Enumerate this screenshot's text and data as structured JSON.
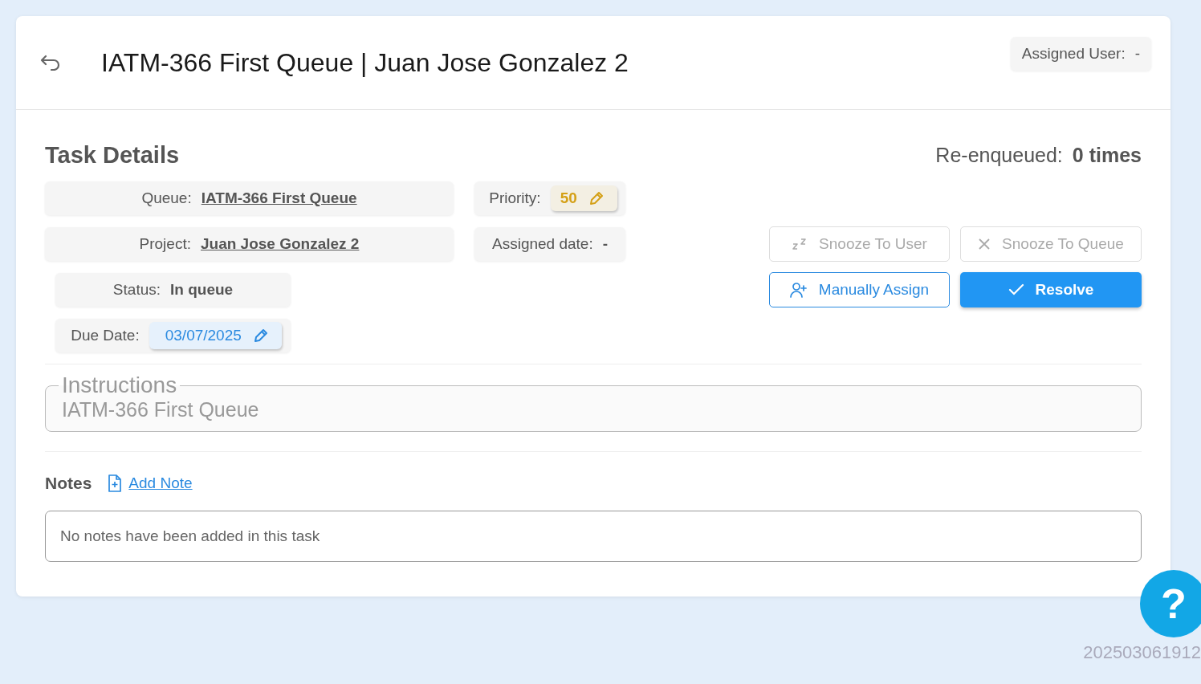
{
  "header": {
    "title": "IATM-366 First Queue | Juan Jose Gonzalez 2",
    "assigned_user": {
      "label": "Assigned User:",
      "value": "-"
    }
  },
  "details": {
    "title": "Task Details",
    "reenqueued": {
      "label": "Re-enqueued:",
      "value": "0 times"
    },
    "fields": [
      {
        "label": "Queue:",
        "value": "IATM-366 First Queue",
        "kind": "link"
      },
      {
        "label": "Priority:",
        "value": "50",
        "kind": "priority"
      },
      {
        "label": "Project:",
        "value": "Juan Jose Gonzalez 2",
        "kind": "link"
      },
      {
        "label": "Assigned date:",
        "value": "-",
        "kind": "plain"
      },
      {
        "label": "Status:",
        "value": "In queue",
        "kind": "plain"
      },
      {
        "label": "Due Date:",
        "value": "03/07/2025",
        "kind": "date"
      }
    ],
    "actions": [
      {
        "label": "Snooze To User",
        "kind": "snooze-user",
        "disabled": true
      },
      {
        "label": "Snooze To Queue",
        "kind": "snooze-queue",
        "disabled": true
      },
      {
        "label": "Manually Assign",
        "kind": "assign",
        "disabled": false
      },
      {
        "label": "Resolve",
        "kind": "resolve",
        "disabled": false
      }
    ]
  },
  "instructions": {
    "label": "Instructions",
    "value": "IATM-366 First Queue"
  },
  "notes": {
    "title": "Notes",
    "add_link": "Add Note",
    "empty_text": "No notes have been added in this task"
  },
  "help_button": {
    "label": "?"
  },
  "version": "202503061912"
}
